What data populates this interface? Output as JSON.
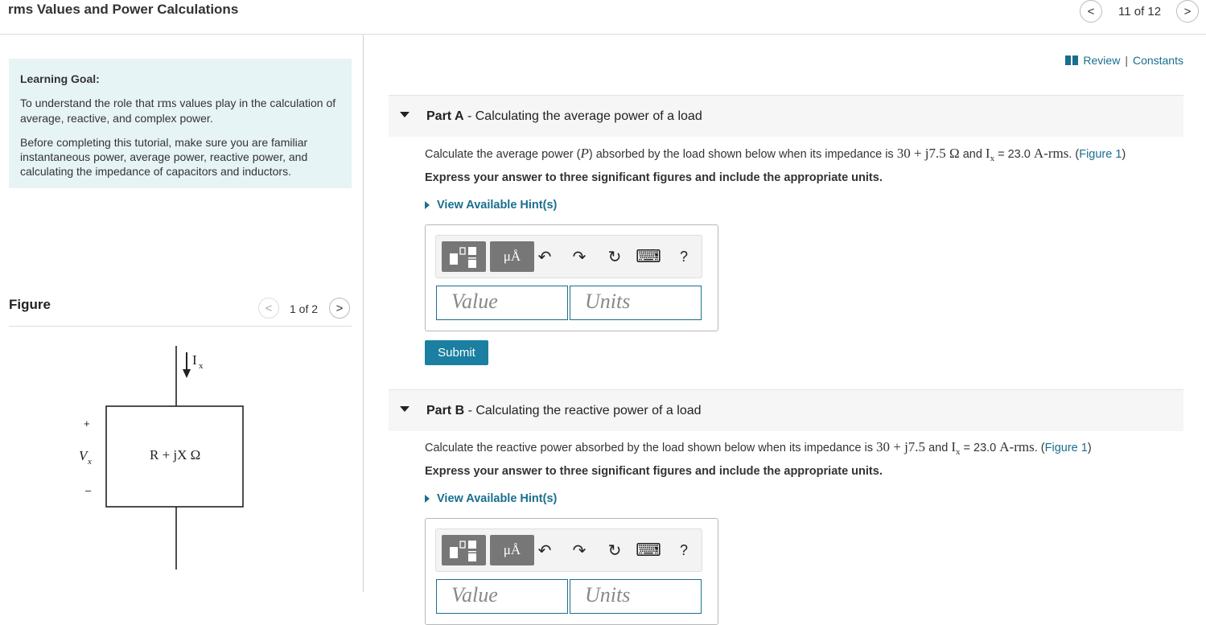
{
  "header": {
    "title": "rms Values and Power Calculations",
    "pager": {
      "prev": "<",
      "text": "11 of 12",
      "next": ">"
    }
  },
  "goal": {
    "title": "Learning Goal:",
    "p1_a": "To understand the role that ",
    "p1_em": "rms",
    "p1_b": " values play in the calculation of average, reactive, and complex power.",
    "p2": "Before completing this tutorial, make sure you are familiar instantaneous power, average power, reactive power, and calculating the impedance of capacitors and inductors."
  },
  "figure": {
    "title": "Figure",
    "pager": {
      "prev": "<",
      "text": "1 of 2",
      "next": ">"
    },
    "circuit": {
      "current_main": "I",
      "current_sub": "x",
      "plus": "+",
      "voltage_main": "V",
      "voltage_sub": "x",
      "minus": "–",
      "impedance": "R + jX Ω"
    }
  },
  "links": {
    "review": "Review",
    "sep": "|",
    "constants": "Constants"
  },
  "parts": [
    {
      "label_bold": "Part A",
      "label_rest": " - Calculating the average power of a load",
      "q_a": "Calculate the average power (",
      "q_p": "P",
      "q_b": ") absorbed by the load shown below when its impedance is ",
      "q_z": "30 + j7.5 Ω",
      "q_c": " and ",
      "q_i": "I",
      "q_isub": "x",
      "q_d": " = 23.0 ",
      "q_unit": "A-rms",
      "q_e": ". (",
      "q_fig": "Figure 1",
      "q_f": ")",
      "instruction": "Express your answer to three significant figures and include the appropriate units.",
      "hint": "View Available Hint(s)",
      "value_placeholder": "Value",
      "units_placeholder": "Units",
      "submit": "Submit"
    },
    {
      "label_bold": "Part B",
      "label_rest": " - Calculating the reactive power of a load",
      "q_a": "Calculate the reactive power absorbed by the load shown below when its impedance is ",
      "q_z": "30 + j7.5",
      "q_c": " and ",
      "q_i": "I",
      "q_isub": "x",
      "q_d": " = 23.0 ",
      "q_unit": "A-rms",
      "q_e": ". (",
      "q_fig": "Figure 1",
      "q_f": ")",
      "instruction": "Express your answer to three significant figures and include the appropriate units.",
      "hint": "View Available Hint(s)",
      "value_placeholder": "Value",
      "units_placeholder": "Units"
    }
  ],
  "toolbar": {
    "mu_label": "μÅ",
    "undo": "↶",
    "redo": "↷",
    "reset": "↻",
    "keyboard": "⌨",
    "help": "?"
  }
}
